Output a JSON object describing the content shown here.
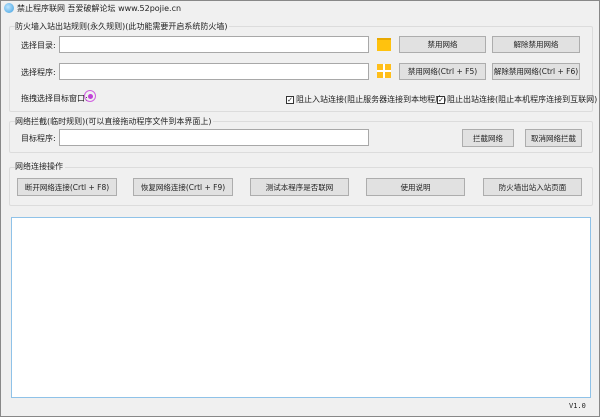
{
  "window": {
    "title": "禁止程序联网 吾爱破解论坛 www.52pojie.cn"
  },
  "permanent": {
    "group_label": "防火墙入站出站规则(永久规则)(此功能需要开启系统防火墙)",
    "dir_label": "选择目录:",
    "dir_value": "",
    "prog_label": "选择程序:",
    "prog_value": "",
    "drag_label": "拖拽选择目标窗口:",
    "disable_net": "禁用网络",
    "enable_net": "解除禁用网络",
    "disable_net_f5": "禁用网络(Ctrl + F5)",
    "enable_net_f6": "解除禁用网络(Ctrl + F6)",
    "block_inbound": "阻止入站连接(阻止服务器连接到本地程序)",
    "block_inbound_checked": true,
    "block_outbound": "阻止出站连接(阻止本机程序连接到互联网)",
    "block_outbound_checked": true
  },
  "temporary": {
    "group_label": "网络拦截(临时规则)(可以直接拖动程序文件到本界面上)",
    "target_label": "目标程序:",
    "target_value": "",
    "block": "拦截网络",
    "unblock": "取消网络拦截"
  },
  "ops": {
    "group_label": "网络连接操作",
    "buttons": [
      "断开网络连接(Crtl + F8)",
      "恢复网络连接(Crtl + F9)",
      "测试本程序是否联网",
      "使用说明",
      "防火墙出站入站页面"
    ]
  },
  "log": {
    "content": ""
  },
  "footer": {
    "version": "V1.0"
  }
}
